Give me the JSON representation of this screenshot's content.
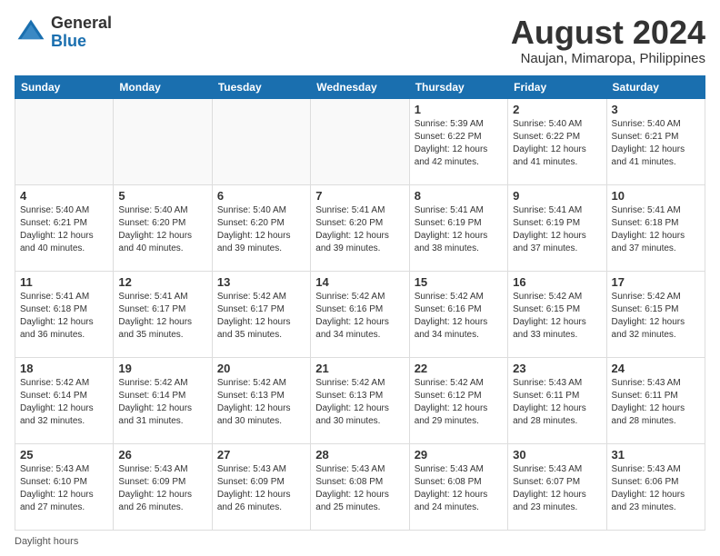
{
  "header": {
    "logo_general": "General",
    "logo_blue": "Blue",
    "main_title": "August 2024",
    "subtitle": "Naujan, Mimaropa, Philippines"
  },
  "days_of_week": [
    "Sunday",
    "Monday",
    "Tuesday",
    "Wednesday",
    "Thursday",
    "Friday",
    "Saturday"
  ],
  "weeks": [
    [
      {
        "day": "",
        "info": ""
      },
      {
        "day": "",
        "info": ""
      },
      {
        "day": "",
        "info": ""
      },
      {
        "day": "",
        "info": ""
      },
      {
        "day": "1",
        "info": "Sunrise: 5:39 AM\nSunset: 6:22 PM\nDaylight: 12 hours and 42 minutes."
      },
      {
        "day": "2",
        "info": "Sunrise: 5:40 AM\nSunset: 6:22 PM\nDaylight: 12 hours and 41 minutes."
      },
      {
        "day": "3",
        "info": "Sunrise: 5:40 AM\nSunset: 6:21 PM\nDaylight: 12 hours and 41 minutes."
      }
    ],
    [
      {
        "day": "4",
        "info": "Sunrise: 5:40 AM\nSunset: 6:21 PM\nDaylight: 12 hours and 40 minutes."
      },
      {
        "day": "5",
        "info": "Sunrise: 5:40 AM\nSunset: 6:20 PM\nDaylight: 12 hours and 40 minutes."
      },
      {
        "day": "6",
        "info": "Sunrise: 5:40 AM\nSunset: 6:20 PM\nDaylight: 12 hours and 39 minutes."
      },
      {
        "day": "7",
        "info": "Sunrise: 5:41 AM\nSunset: 6:20 PM\nDaylight: 12 hours and 39 minutes."
      },
      {
        "day": "8",
        "info": "Sunrise: 5:41 AM\nSunset: 6:19 PM\nDaylight: 12 hours and 38 minutes."
      },
      {
        "day": "9",
        "info": "Sunrise: 5:41 AM\nSunset: 6:19 PM\nDaylight: 12 hours and 37 minutes."
      },
      {
        "day": "10",
        "info": "Sunrise: 5:41 AM\nSunset: 6:18 PM\nDaylight: 12 hours and 37 minutes."
      }
    ],
    [
      {
        "day": "11",
        "info": "Sunrise: 5:41 AM\nSunset: 6:18 PM\nDaylight: 12 hours and 36 minutes."
      },
      {
        "day": "12",
        "info": "Sunrise: 5:41 AM\nSunset: 6:17 PM\nDaylight: 12 hours and 35 minutes."
      },
      {
        "day": "13",
        "info": "Sunrise: 5:42 AM\nSunset: 6:17 PM\nDaylight: 12 hours and 35 minutes."
      },
      {
        "day": "14",
        "info": "Sunrise: 5:42 AM\nSunset: 6:16 PM\nDaylight: 12 hours and 34 minutes."
      },
      {
        "day": "15",
        "info": "Sunrise: 5:42 AM\nSunset: 6:16 PM\nDaylight: 12 hours and 34 minutes."
      },
      {
        "day": "16",
        "info": "Sunrise: 5:42 AM\nSunset: 6:15 PM\nDaylight: 12 hours and 33 minutes."
      },
      {
        "day": "17",
        "info": "Sunrise: 5:42 AM\nSunset: 6:15 PM\nDaylight: 12 hours and 32 minutes."
      }
    ],
    [
      {
        "day": "18",
        "info": "Sunrise: 5:42 AM\nSunset: 6:14 PM\nDaylight: 12 hours and 32 minutes."
      },
      {
        "day": "19",
        "info": "Sunrise: 5:42 AM\nSunset: 6:14 PM\nDaylight: 12 hours and 31 minutes."
      },
      {
        "day": "20",
        "info": "Sunrise: 5:42 AM\nSunset: 6:13 PM\nDaylight: 12 hours and 30 minutes."
      },
      {
        "day": "21",
        "info": "Sunrise: 5:42 AM\nSunset: 6:13 PM\nDaylight: 12 hours and 30 minutes."
      },
      {
        "day": "22",
        "info": "Sunrise: 5:42 AM\nSunset: 6:12 PM\nDaylight: 12 hours and 29 minutes."
      },
      {
        "day": "23",
        "info": "Sunrise: 5:43 AM\nSunset: 6:11 PM\nDaylight: 12 hours and 28 minutes."
      },
      {
        "day": "24",
        "info": "Sunrise: 5:43 AM\nSunset: 6:11 PM\nDaylight: 12 hours and 28 minutes."
      }
    ],
    [
      {
        "day": "25",
        "info": "Sunrise: 5:43 AM\nSunset: 6:10 PM\nDaylight: 12 hours and 27 minutes."
      },
      {
        "day": "26",
        "info": "Sunrise: 5:43 AM\nSunset: 6:09 PM\nDaylight: 12 hours and 26 minutes."
      },
      {
        "day": "27",
        "info": "Sunrise: 5:43 AM\nSunset: 6:09 PM\nDaylight: 12 hours and 26 minutes."
      },
      {
        "day": "28",
        "info": "Sunrise: 5:43 AM\nSunset: 6:08 PM\nDaylight: 12 hours and 25 minutes."
      },
      {
        "day": "29",
        "info": "Sunrise: 5:43 AM\nSunset: 6:08 PM\nDaylight: 12 hours and 24 minutes."
      },
      {
        "day": "30",
        "info": "Sunrise: 5:43 AM\nSunset: 6:07 PM\nDaylight: 12 hours and 23 minutes."
      },
      {
        "day": "31",
        "info": "Sunrise: 5:43 AM\nSunset: 6:06 PM\nDaylight: 12 hours and 23 minutes."
      }
    ]
  ],
  "footer": {
    "note": "Daylight hours"
  }
}
